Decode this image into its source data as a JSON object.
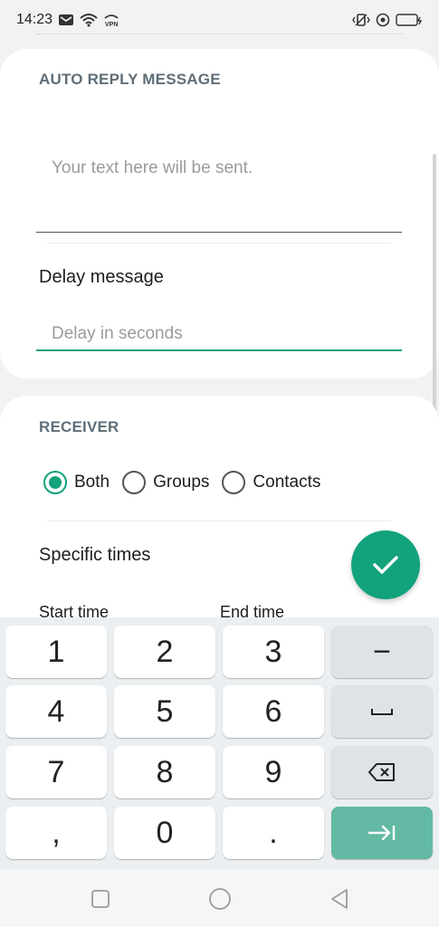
{
  "status_bar": {
    "time": "14:23",
    "left_icons": [
      "mail-icon",
      "wifi-icon",
      "vpn-icon"
    ],
    "right_icons": [
      "vibrate-icon",
      "alarm-icon",
      "battery-charging-icon"
    ]
  },
  "auto_reply": {
    "title": "AUTO REPLY MESSAGE",
    "message_placeholder": "Your text here will be sent.",
    "delay_label": "Delay message",
    "delay_placeholder": "Delay in seconds"
  },
  "receiver": {
    "title": "RECEIVER",
    "options": [
      {
        "label": "Both",
        "selected": true
      },
      {
        "label": "Groups",
        "selected": false
      },
      {
        "label": "Contacts",
        "selected": false
      }
    ],
    "specific_times_label": "Specific times",
    "start_time_label": "Start time",
    "end_time_label": "End time"
  },
  "keyboard": {
    "rows": [
      [
        "1",
        "2",
        "3",
        "−"
      ],
      [
        "4",
        "5",
        "6",
        "space"
      ],
      [
        "7",
        "8",
        "9",
        "backspace"
      ],
      [
        ",",
        "0",
        ".",
        "go"
      ]
    ]
  },
  "nav_bar": [
    "recent-apps-icon",
    "home-icon",
    "back-icon"
  ],
  "colors": {
    "accent": "#12a27c",
    "title_gray": "#5f6e78",
    "go_key": "#63b9a4"
  }
}
